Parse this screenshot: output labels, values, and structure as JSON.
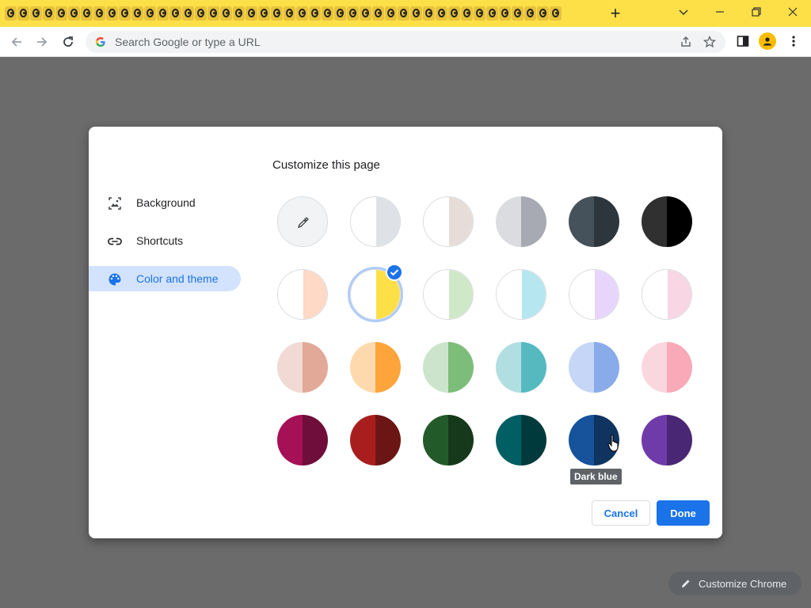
{
  "browser": {
    "omnibox": {
      "placeholder": "Search Google or type a URL"
    },
    "tab_icon": "skull-icon",
    "tab_count": 44
  },
  "dialog": {
    "title": "Customize this page",
    "sidebar": [
      {
        "label": "Background",
        "icon": "image-icon"
      },
      {
        "label": "Shortcuts",
        "icon": "link-icon"
      },
      {
        "label": "Color and theme",
        "icon": "palette-icon",
        "active": true
      }
    ],
    "swatches": [
      [
        "#f1f3f4",
        "#f1f3f4"
      ],
      [
        "#ffffff",
        "#dee1e6"
      ],
      [
        "#ffffff",
        "#e6ddd9"
      ],
      [
        "#dadce0",
        "#a8aab3"
      ],
      [
        "#45525c",
        "#2d363c"
      ],
      [
        "#303030",
        "#000000"
      ],
      [
        "#ffffff",
        "#fdd9c6"
      ],
      [
        "#ffffff",
        "#fde047"
      ],
      [
        "#ffffff",
        "#cfe8c8"
      ],
      [
        "#ffffff",
        "#b6e6f0"
      ],
      [
        "#ffffff",
        "#e8d5fb"
      ],
      [
        "#ffffff",
        "#f8d6e4"
      ],
      [
        "#f0dad3",
        "#e2a898"
      ],
      [
        "#fed9ad",
        "#fda53b"
      ],
      [
        "#cbe4cb",
        "#7dbd7a"
      ],
      [
        "#b1dfe1",
        "#56b9c0"
      ],
      [
        "#c5d6f6",
        "#89abea"
      ],
      [
        "#fad7df",
        "#f9a9b8"
      ],
      [
        "#a61056",
        "#6f0e3a"
      ],
      [
        "#a81e1e",
        "#6b1515"
      ],
      [
        "#235a2a",
        "#16391b"
      ],
      [
        "#005f63",
        "#003a3d"
      ],
      [
        "#17539b",
        "#0e345f"
      ],
      [
        "#6f3ba9",
        "#4a2775"
      ]
    ],
    "selected_index": 7,
    "eyedropper_index": 0,
    "tooltip": "Dark blue",
    "cancel_label": "Cancel",
    "done_label": "Done"
  },
  "customize_chrome": {
    "label": "Customize Chrome"
  }
}
